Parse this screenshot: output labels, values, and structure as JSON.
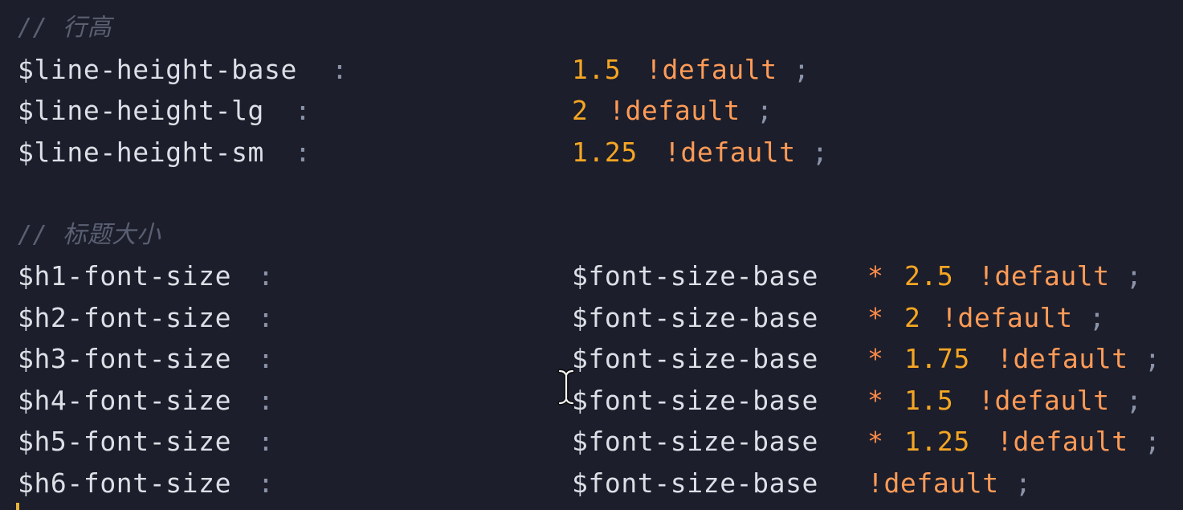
{
  "theme": {
    "background": "#1c1e2b",
    "variable": "#dcdfe6",
    "number": "#f5a623",
    "keyword": "#ff9b57",
    "operator": "#ff8c4a",
    "punctuation": "#8b93a8",
    "comment": "#5a6072",
    "caret": "#e8b23a"
  },
  "editor": {
    "lines": [
      {
        "segments": [
          {
            "text": "// 行高",
            "type": "comment"
          }
        ]
      },
      {
        "segments": [
          {
            "text": "$line-height-base",
            "type": "variable",
            "col": 0
          },
          {
            "text": ":",
            "type": "punctuation",
            "col": 17
          },
          {
            "text": "1.5",
            "type": "number",
            "col": 30
          },
          {
            "text": "!default",
            "type": "keyword",
            "col": 34
          },
          {
            "text": ";",
            "type": "punctuation",
            "col": 42
          }
        ]
      },
      {
        "segments": [
          {
            "text": "$line-height-lg",
            "type": "variable",
            "col": 0
          },
          {
            "text": ":",
            "type": "punctuation",
            "col": 15
          },
          {
            "text": "2",
            "type": "number",
            "col": 30
          },
          {
            "text": "!default",
            "type": "keyword",
            "col": 32
          },
          {
            "text": ";",
            "type": "punctuation",
            "col": 40
          }
        ]
      },
      {
        "segments": [
          {
            "text": "$line-height-sm",
            "type": "variable",
            "col": 0
          },
          {
            "text": ":",
            "type": "punctuation",
            "col": 15
          },
          {
            "text": "1.25",
            "type": "number",
            "col": 30
          },
          {
            "text": "!default",
            "type": "keyword",
            "col": 35
          },
          {
            "text": ";",
            "type": "punctuation",
            "col": 43
          }
        ]
      },
      {
        "segments": []
      },
      {
        "segments": [
          {
            "text": "// 标题大小",
            "type": "comment"
          }
        ]
      },
      {
        "segments": [
          {
            "text": "$h1-font-size",
            "type": "variable",
            "col": 0
          },
          {
            "text": ":",
            "type": "punctuation",
            "col": 13
          },
          {
            "text": "$font-size-base",
            "type": "variable",
            "col": 30
          },
          {
            "text": "*",
            "type": "operator",
            "col": 46
          },
          {
            "text": "2.5",
            "type": "number",
            "col": 48
          },
          {
            "text": "!default",
            "type": "keyword",
            "col": 52
          },
          {
            "text": ";",
            "type": "punctuation",
            "col": 60
          }
        ]
      },
      {
        "segments": [
          {
            "text": "$h2-font-size",
            "type": "variable",
            "col": 0
          },
          {
            "text": ":",
            "type": "punctuation",
            "col": 13
          },
          {
            "text": "$font-size-base",
            "type": "variable",
            "col": 30
          },
          {
            "text": "*",
            "type": "operator",
            "col": 46
          },
          {
            "text": "2",
            "type": "number",
            "col": 48
          },
          {
            "text": "!default",
            "type": "keyword",
            "col": 50
          },
          {
            "text": ";",
            "type": "punctuation",
            "col": 58
          }
        ]
      },
      {
        "segments": [
          {
            "text": "$h3-font-size",
            "type": "variable",
            "col": 0
          },
          {
            "text": ":",
            "type": "punctuation",
            "col": 13
          },
          {
            "text": "$font-size-base",
            "type": "variable",
            "col": 30
          },
          {
            "text": "*",
            "type": "operator",
            "col": 46
          },
          {
            "text": "1.75",
            "type": "number",
            "col": 48
          },
          {
            "text": "!default",
            "type": "keyword",
            "col": 53
          },
          {
            "text": ";",
            "type": "punctuation",
            "col": 61
          }
        ]
      },
      {
        "segments": [
          {
            "text": "$h4-font-size",
            "type": "variable",
            "col": 0
          },
          {
            "text": ":",
            "type": "punctuation",
            "col": 13
          },
          {
            "text": "$font-size-base",
            "type": "variable",
            "col": 30
          },
          {
            "text": "*",
            "type": "operator",
            "col": 46
          },
          {
            "text": "1.5",
            "type": "number",
            "col": 48
          },
          {
            "text": "!default",
            "type": "keyword",
            "col": 52
          },
          {
            "text": ";",
            "type": "punctuation",
            "col": 60
          }
        ]
      },
      {
        "segments": [
          {
            "text": "$h5-font-size",
            "type": "variable",
            "col": 0
          },
          {
            "text": ":",
            "type": "punctuation",
            "col": 13
          },
          {
            "text": "$font-size-base",
            "type": "variable",
            "col": 30
          },
          {
            "text": "*",
            "type": "operator",
            "col": 46
          },
          {
            "text": "1.25",
            "type": "number",
            "col": 48
          },
          {
            "text": "!default",
            "type": "keyword",
            "col": 53
          },
          {
            "text": ";",
            "type": "punctuation",
            "col": 61
          }
        ]
      },
      {
        "segments": [
          {
            "text": "$h6-font-size",
            "type": "variable",
            "col": 0
          },
          {
            "text": ":",
            "type": "punctuation",
            "col": 13
          },
          {
            "text": "$font-size-base",
            "type": "variable",
            "col": 30
          },
          {
            "text": "!default",
            "type": "keyword",
            "col": 46
          },
          {
            "text": ";",
            "type": "punctuation",
            "col": 54
          }
        ]
      }
    ]
  },
  "cursor": {
    "icon": "text-cursor-icon"
  }
}
